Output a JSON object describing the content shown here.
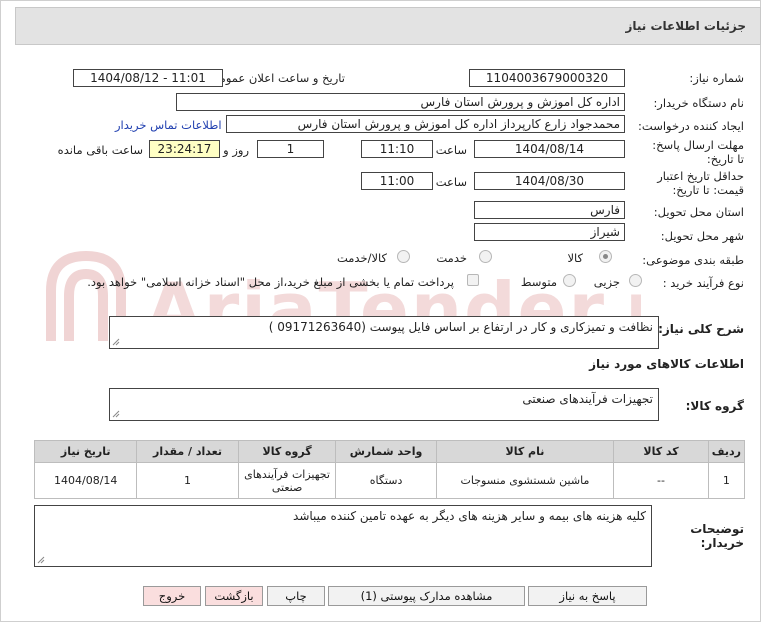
{
  "header": {
    "title": "جزئیات اطلاعات نیاز"
  },
  "form": {
    "need_number_label": "شماره نیاز:",
    "need_number": "1104003679000320",
    "announce_label": "تاریخ و ساعت اعلان عمومی:",
    "announce_value": "1404/08/12 - 11:01",
    "buyer_org_label": "نام دستگاه خریدار:",
    "buyer_org": "اداره کل اموزش و پرورش استان فارس",
    "requester_label": "ایجاد کننده درخواست:",
    "requester": "محمدجواد زارع کارپرداز اداره کل اموزش و پرورش استان فارس",
    "contact_link": "اطلاعات تماس خریدار",
    "deadline_label": "مهلت ارسال پاسخ: تا تاریخ:",
    "deadline_date": "1404/08/14",
    "time_label": "ساعت",
    "deadline_time": "11:10",
    "days_value": "1",
    "days_label": "روز و",
    "remaining_time": "23:24:17",
    "remaining_label": "ساعت باقی مانده",
    "validity_label": "حداقل تاریخ اعتبار قیمت: تا تاریخ:",
    "validity_date": "1404/08/30",
    "validity_time": "11:00",
    "province_label": "استان محل تحویل:",
    "province": "فارس",
    "city_label": "شهر محل تحویل:",
    "city": "شیراز",
    "category_label": "طبقه بندی موضوعی:",
    "category_options": [
      "کالا",
      "خدمت",
      "کالا/خدمت"
    ],
    "process_label": "نوع فرآیند خرید :",
    "process_options": [
      "جزیی",
      "متوسط"
    ],
    "payment_note": "پرداخت تمام یا بخشی از مبلغ خرید،از محل \"اسناد خزانه اسلامی\" خواهد بود."
  },
  "description": {
    "label": "شرح کلی نیاز:",
    "text": "نظافت و تمیزکاری و کار در ارتفاع بر اساس فایل پیوست  (09171263640 )"
  },
  "goods": {
    "section_title": "اطلاعات کالاهای مورد نیاز",
    "group_label": "گروه کالا:",
    "group_value": "تجهیزات فرآیندهای صنعتی",
    "columns": [
      "ردیف",
      "کد کالا",
      "نام کالا",
      "واحد شمارش",
      "گروه کالا",
      "تعداد / مقدار",
      "تاریخ نیاز"
    ],
    "rows": [
      [
        "1",
        "--",
        "ماشین شستشوی منسوجات",
        "دستگاه",
        "تجهیزات فرآیندهای صنعتی",
        "1",
        "1404/08/14"
      ]
    ]
  },
  "buyer_notes": {
    "label": "توضیحات خریدار:",
    "text": "کلیه هزینه های بیمه و سایر هزینه های دیگر به عهده تامین کننده میباشد"
  },
  "buttons": {
    "reply": "پاسخ به نیاز",
    "docs": "مشاهده مدارک پیوستی (1)",
    "print": "چاپ",
    "back": "بازگشت",
    "exit": "خروج"
  },
  "colors": {
    "header_bg": "#e3e3e3",
    "yellow_field": "#ffffc4",
    "link": "#2140b0",
    "button_pink": "#fadede"
  },
  "watermark_text": "AriaTender.neT"
}
